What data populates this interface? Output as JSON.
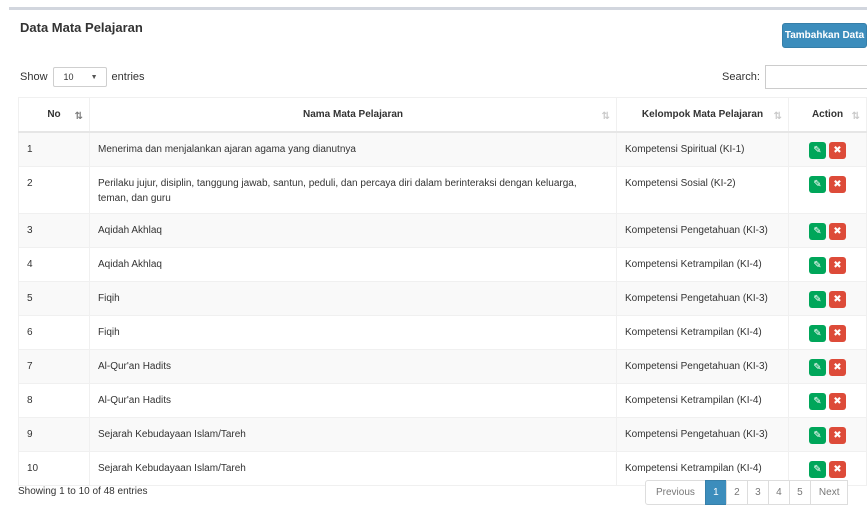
{
  "panel": {
    "title": "Data Mata Pelajaran",
    "add_button": "Tambahkan Data"
  },
  "length": {
    "show": "Show",
    "value": "10",
    "entries": "entries"
  },
  "search": {
    "label": "Search:",
    "value": ""
  },
  "table": {
    "headers": {
      "no": "No",
      "nama": "Nama Mata Pelajaran",
      "kelompok": "Kelompok Mata Pelajaran",
      "action": "Action"
    },
    "rows": [
      {
        "no": "1",
        "nama": "Menerima dan menjalankan ajaran agama yang dianutnya",
        "kelompok": "Kompetensi Spiritual (KI-1)"
      },
      {
        "no": "2",
        "nama": "Perilaku jujur, disiplin, tanggung jawab, santun, peduli, dan percaya diri dalam berinteraksi dengan keluarga, teman, dan guru",
        "kelompok": "Kompetensi Sosial (KI-2)"
      },
      {
        "no": "3",
        "nama": "Aqidah Akhlaq",
        "kelompok": "Kompetensi Pengetahuan (KI-3)"
      },
      {
        "no": "4",
        "nama": "Aqidah Akhlaq",
        "kelompok": "Kompetensi Ketrampilan (KI-4)"
      },
      {
        "no": "5",
        "nama": "Fiqih",
        "kelompok": "Kompetensi Pengetahuan (KI-3)"
      },
      {
        "no": "6",
        "nama": "Fiqih",
        "kelompok": "Kompetensi Ketrampilan (KI-4)"
      },
      {
        "no": "7",
        "nama": "Al-Qur'an Hadits",
        "kelompok": "Kompetensi Pengetahuan (KI-3)"
      },
      {
        "no": "8",
        "nama": "Al-Qur'an Hadits",
        "kelompok": "Kompetensi Ketrampilan (KI-4)"
      },
      {
        "no": "9",
        "nama": "Sejarah Kebudayaan Islam/Tareh",
        "kelompok": "Kompetensi Pengetahuan (KI-3)"
      },
      {
        "no": "10",
        "nama": "Sejarah Kebudayaan Islam/Tareh",
        "kelompok": "Kompetensi Ketrampilan (KI-4)"
      }
    ]
  },
  "info": "Showing 1 to 10 of 48 entries",
  "pagination": {
    "previous": "Previous",
    "pages": [
      "1",
      "2",
      "3",
      "4",
      "5"
    ],
    "active": "1",
    "next": "Next"
  },
  "icons": {
    "edit": "edit-icon",
    "delete": "delete-icon",
    "sort": "sort-icon"
  },
  "colors": {
    "primary": "#3c8dbc",
    "edit": "#00a65a",
    "delete": "#dd4b39"
  }
}
